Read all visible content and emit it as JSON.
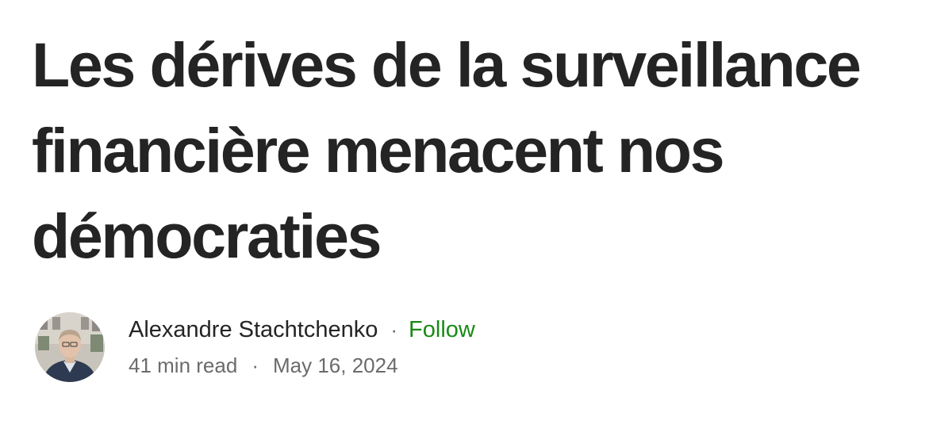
{
  "article": {
    "title": "Les dérives de la surveillance financière menacent nos démocraties"
  },
  "byline": {
    "author_name": "Alexandre Stachtchenko",
    "separator": "·",
    "follow_label": "Follow",
    "read_time": "41 min read",
    "date": "May 16, 2024"
  },
  "colors": {
    "title": "#242424",
    "meta": "#6b6b6b",
    "follow": "#1a8917"
  },
  "icons": {
    "avatar": "author-avatar-photo"
  }
}
